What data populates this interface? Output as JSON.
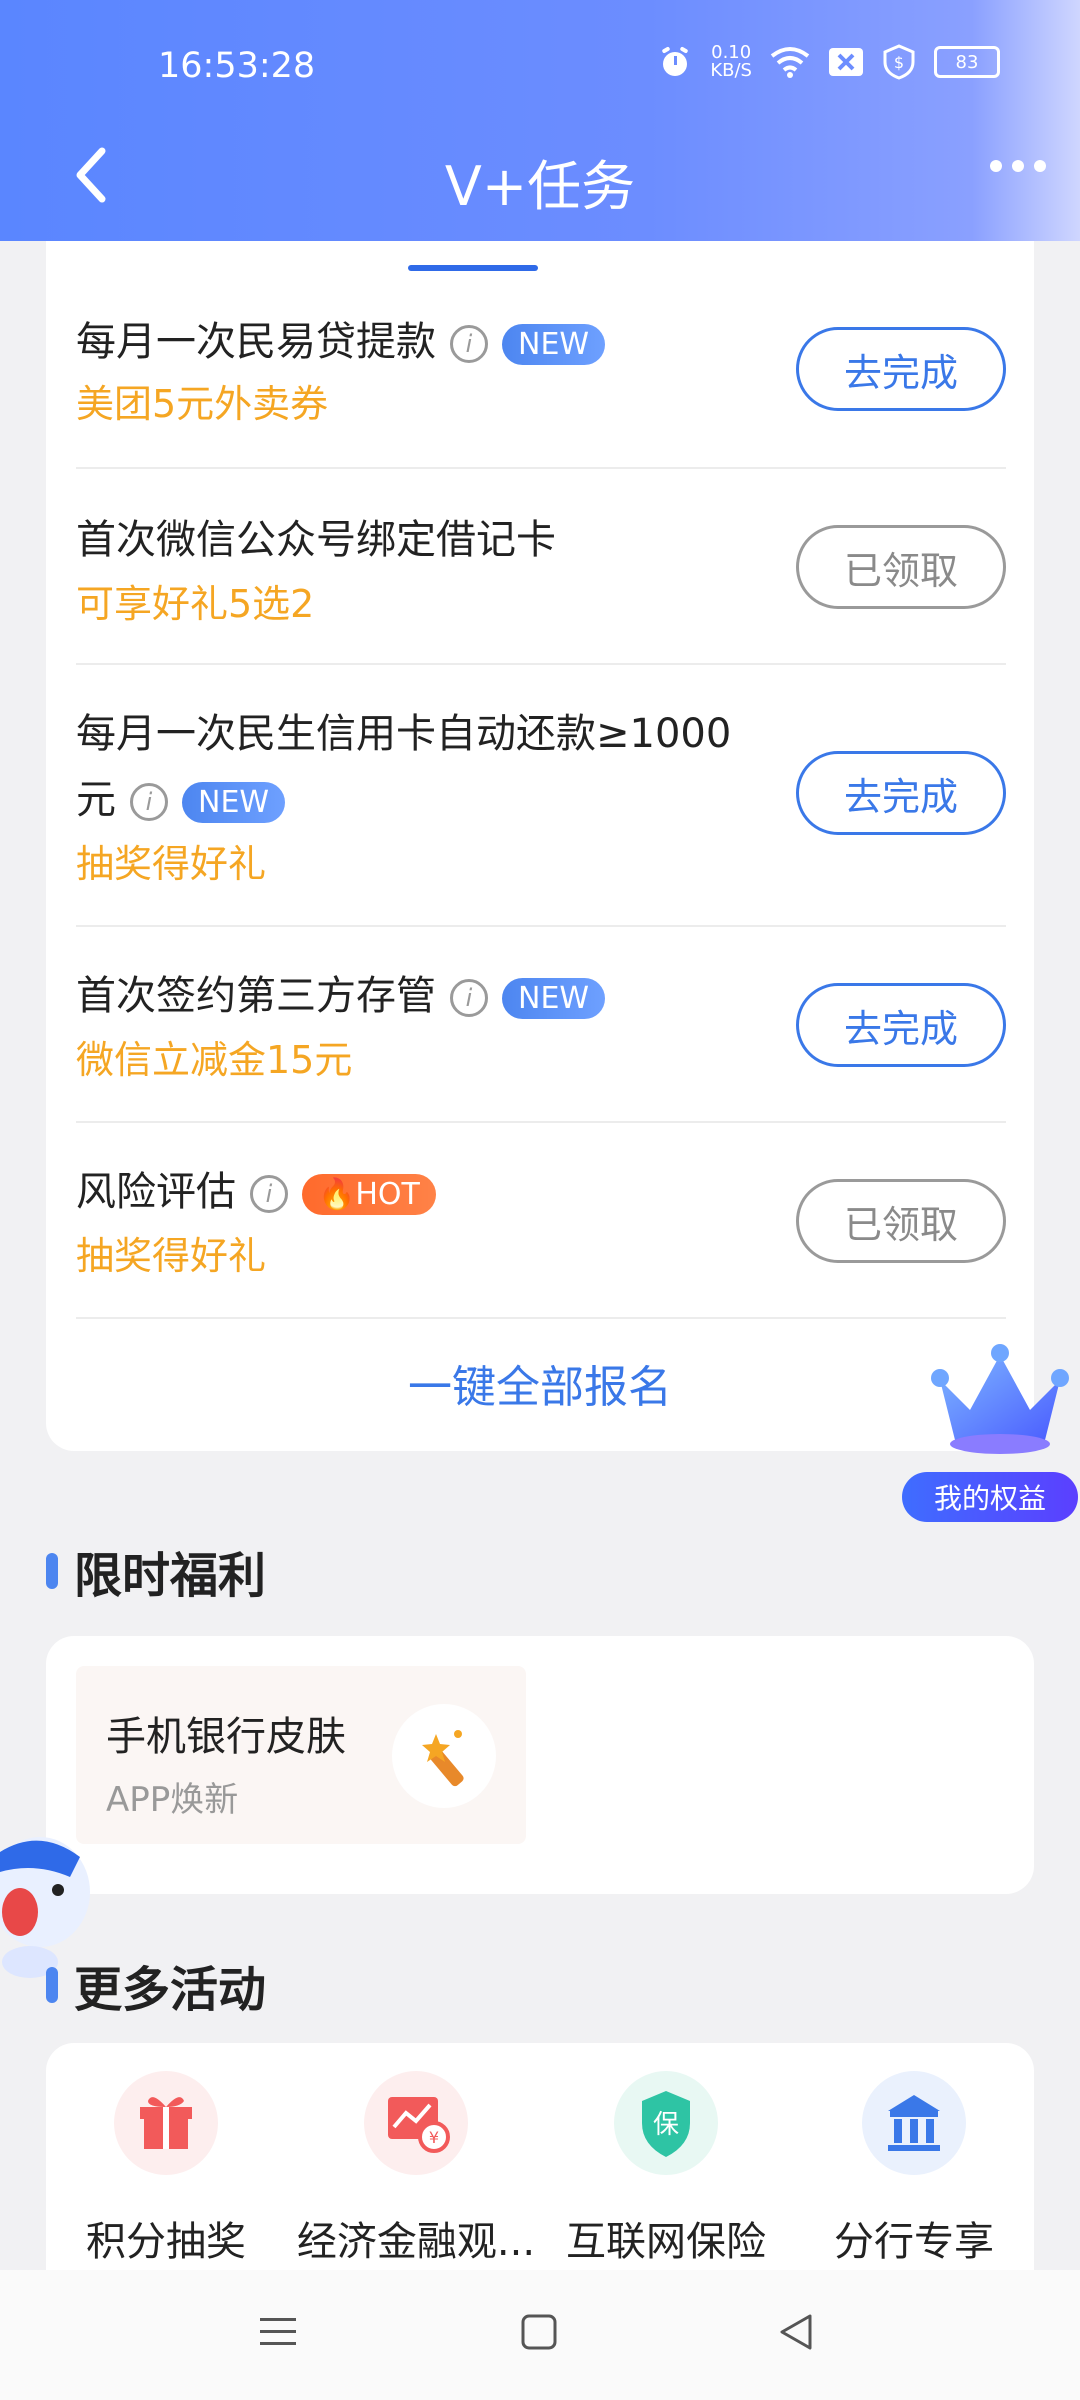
{
  "status": {
    "time": "16:53:28",
    "net_speed_value": "0.10",
    "net_speed_unit": "KB/S",
    "battery": "83"
  },
  "header": {
    "title": "V+任务"
  },
  "tasks": [
    {
      "title": "每月一次民易贷提款",
      "reward": "美团5元外卖券",
      "badge": "NEW",
      "button": "去完成"
    },
    {
      "title": "首次微信公众号绑定借记卡",
      "reward": "可享好礼5选2",
      "button": "已领取"
    },
    {
      "title_line1": "每月一次民生信用卡自动还款≥1000",
      "title_line2": "元",
      "badge": "NEW",
      "reward": "抽奖得好礼",
      "button": "去完成"
    },
    {
      "title": "首次签约第三方存管",
      "reward": "微信立减金15元",
      "badge": "NEW",
      "button": "去完成"
    },
    {
      "title": "风险评估",
      "reward": "抽奖得好礼",
      "badge": "HOT",
      "button": "已领取"
    }
  ],
  "enroll_all": "一键全部报名",
  "my_rights": "我的权益",
  "limited": {
    "title": "限时福利",
    "item": {
      "title": "手机银行皮肤",
      "subtitle": "APP焕新"
    }
  },
  "activities": {
    "title": "更多活动",
    "items": [
      {
        "label": "积分抽奖",
        "icon": "gift-icon",
        "color": "#f25a5a"
      },
      {
        "label": "经济金融观...",
        "icon": "chart-coin-icon",
        "color": "#f25a5a"
      },
      {
        "label": "互联网保险",
        "icon": "shield-icon",
        "color": "#2ec4a4",
        "glyph": "保"
      },
      {
        "label": "分行专享",
        "icon": "bank-icon",
        "color": "#3a78e8"
      }
    ]
  },
  "colors": {
    "accent": "#3a78e8",
    "reward": "#f5a623",
    "hot": "#ff6a2c"
  }
}
